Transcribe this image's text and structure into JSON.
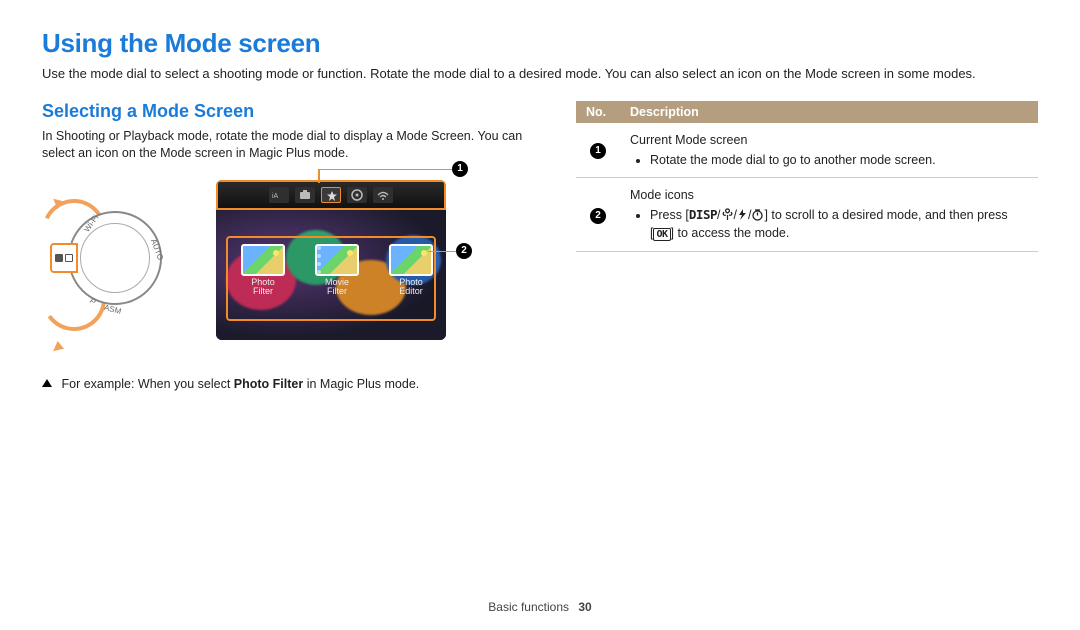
{
  "page_title": "Using the Mode screen",
  "intro": "Use the mode dial to select a shooting mode or function. Rotate the mode dial to a desired mode. You can also select an icon on the Mode screen in some modes.",
  "section_title": "Selecting a Mode Screen",
  "section_body": "In Shooting or Playback mode, rotate the mode dial to display a Mode Screen. You can select an icon on the Mode screen in Magic Plus mode.",
  "dial_labels": {
    "wifi": "Wi-Fi",
    "auto": "AUTO",
    "p": "P",
    "asm": "ASM"
  },
  "callouts": {
    "one": "1",
    "two": "2"
  },
  "thumbs": [
    {
      "label_line1": "Photo",
      "label_line2": "Filter"
    },
    {
      "label_line1": "Movie",
      "label_line2": "Filter"
    },
    {
      "label_line1": "Photo",
      "label_line2": "Editor"
    }
  ],
  "caption_prefix": "For example: When you select ",
  "caption_bold": "Photo Filter",
  "caption_suffix": " in Magic Plus mode.",
  "table": {
    "head_no": "No.",
    "head_desc": "Description",
    "rows": [
      {
        "num": "1",
        "title": "Current Mode screen",
        "bullet": "Rotate the mode dial to go to another mode screen."
      },
      {
        "num": "2",
        "title": "Mode icons",
        "bullet_prefix": "Press [",
        "disp": "DISP",
        "slash1": "/",
        "icon_macro": "macro-icon",
        "slash2": "/",
        "icon_flash": "flash-icon",
        "slash3": "/",
        "icon_timer": "timer-icon",
        "bullet_mid": "] to scroll to a desired mode, and then press [",
        "ok": "OK",
        "bullet_suffix": "] to access the mode."
      }
    ]
  },
  "footer_section": "Basic functions",
  "footer_page": "30"
}
